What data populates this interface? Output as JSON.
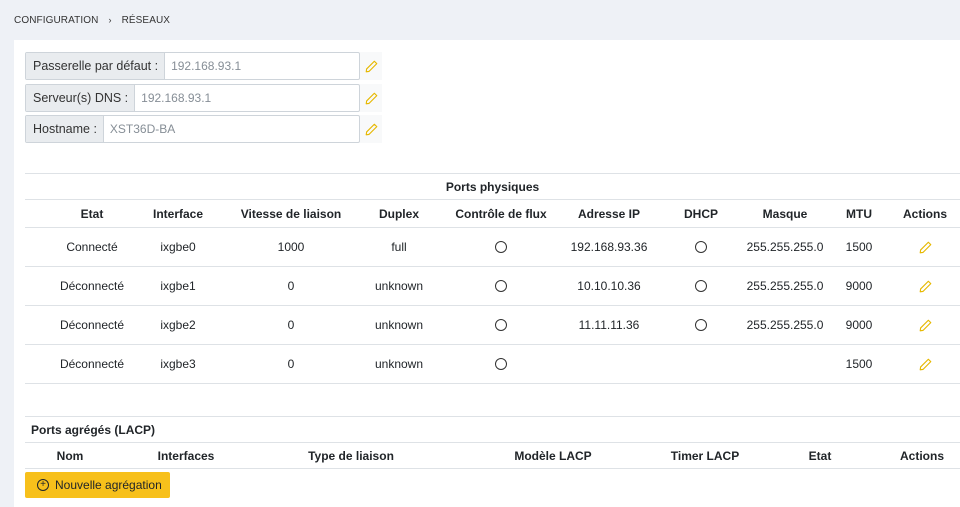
{
  "breadcrumb": {
    "root": "CONFIGURATION",
    "separator": "›",
    "current": "RÉSEAUX"
  },
  "gateway": {
    "label": "Passerelle par défaut :",
    "value": "192.168.93.1"
  },
  "dns": {
    "label": "Serveur(s) DNS :",
    "value": "192.168.93.1"
  },
  "hostname": {
    "label": "Hostname :",
    "value": "XST36D-BA"
  },
  "physical": {
    "caption": "Ports physiques",
    "headers": [
      "Etat",
      "Interface",
      "Vitesse de liaison",
      "Duplex",
      "Contrôle de flux",
      "Adresse IP",
      "DHCP",
      "Masque",
      "MTU",
      "Actions"
    ],
    "rows": [
      {
        "etat": "Connecté",
        "interface": "ixgbe0",
        "vitesse": "1000",
        "duplex": "full",
        "ip": "192.168.93.36",
        "dhcp": true,
        "masque": "255.255.255.0",
        "mtu": "1500"
      },
      {
        "etat": "Déconnecté",
        "interface": "ixgbe1",
        "vitesse": "0",
        "duplex": "unknown",
        "ip": "10.10.10.36",
        "dhcp": true,
        "masque": "255.255.255.0",
        "mtu": "9000"
      },
      {
        "etat": "Déconnecté",
        "interface": "ixgbe2",
        "vitesse": "0",
        "duplex": "unknown",
        "ip": "11.11.11.36",
        "dhcp": true,
        "masque": "255.255.255.0",
        "mtu": "9000"
      },
      {
        "etat": "Déconnecté",
        "interface": "ixgbe3",
        "vitesse": "0",
        "duplex": "unknown",
        "ip": "",
        "dhcp": false,
        "masque": "",
        "mtu": "1500"
      }
    ]
  },
  "lacp": {
    "caption": "Ports agrégés (LACP)",
    "headers": [
      "Nom",
      "Interfaces",
      "Type de liaison",
      "Modèle LACP",
      "Timer LACP",
      "Etat",
      "Actions"
    ],
    "add_label": "Nouvelle agrégation"
  },
  "colors": {
    "accent": "#f7c01b",
    "pencil": "#e6b800",
    "border": "#dee2e6",
    "label_bg": "#e9ecef",
    "page_bg": "#eef1f6"
  },
  "icons": {
    "edit": "pencil-icon",
    "flow_control": "radio-icon",
    "dhcp": "radio-icon",
    "add": "plus-circle-icon",
    "separator": "chevron-right-icon"
  }
}
